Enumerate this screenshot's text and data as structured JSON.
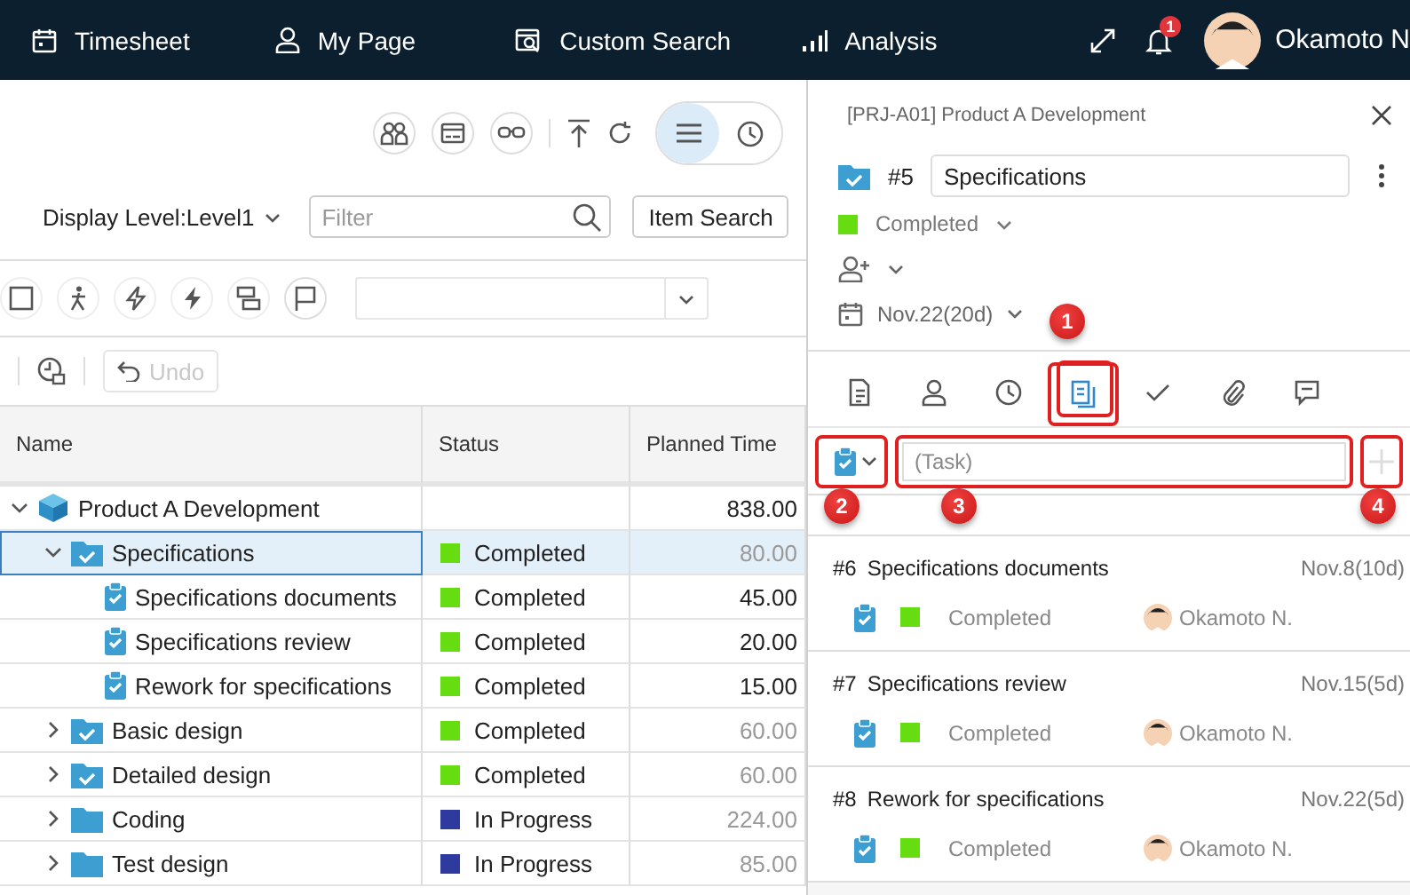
{
  "nav": {
    "items": [
      {
        "label": "Timesheet"
      },
      {
        "label": "My Page"
      },
      {
        "label": "Custom Search"
      },
      {
        "label": "Analysis"
      }
    ],
    "notifications": "1",
    "user": "Okamoto N"
  },
  "toolbar": {
    "view_toggle": [
      {
        "selected": true
      },
      {
        "selected": false
      }
    ],
    "display_level": "Display Level:Level1",
    "filter": {
      "placeholder": "Filter"
    },
    "item_search_button": "Item Search",
    "undo_button": {
      "label": "Undo",
      "disabled": true
    }
  },
  "table": {
    "columns": [
      "Name",
      "Status",
      "Planned Time"
    ],
    "rows": [
      {
        "kind": "project",
        "name": "Product A Development",
        "expanded": true,
        "selected": false,
        "planned": "838.00",
        "children": [
          {
            "kind": "done-folder",
            "name": "Specifications",
            "expanded": true,
            "selected": true,
            "status": "Completed",
            "color": "#66dd11",
            "planned": "80.00",
            "children": [
              {
                "kind": "task",
                "name": "Specifications documents",
                "selected": false,
                "status": "Completed",
                "color": "#66dd11",
                "planned": "45.00"
              },
              {
                "kind": "task",
                "name": "Specifications review",
                "selected": false,
                "status": "Completed",
                "color": "#66dd11",
                "planned": "20.00"
              },
              {
                "kind": "task",
                "name": "Rework for specifications",
                "selected": false,
                "status": "Completed",
                "color": "#66dd11",
                "planned": "15.00"
              }
            ]
          },
          {
            "kind": "done-folder",
            "name": "Basic design",
            "expanded": false,
            "selected": false,
            "status": "Completed",
            "color": "#66dd11",
            "planned": "60.00"
          },
          {
            "kind": "done-folder",
            "name": "Detailed design",
            "expanded": false,
            "selected": false,
            "status": "Completed",
            "color": "#66dd11",
            "planned": "60.00"
          },
          {
            "kind": "folder",
            "name": "Coding",
            "expanded": false,
            "selected": false,
            "status": "In Progress",
            "color": "#2e3a9e",
            "planned": "224.00"
          },
          {
            "kind": "folder",
            "name": "Test design",
            "expanded": false,
            "selected": false,
            "status": "In Progress",
            "color": "#2e3a9e",
            "planned": "85.00"
          }
        ]
      }
    ]
  },
  "detail": {
    "breadcrumb": "[PRJ-A01] Product A Development",
    "number": "#5",
    "title": "Specifications",
    "status": {
      "label": "Completed",
      "color": "#66dd11"
    },
    "due": "Nov.22(20d)",
    "tabs": [
      {
        "selected": false,
        "highlighted": false
      },
      {
        "selected": false,
        "highlighted": false
      },
      {
        "selected": false,
        "highlighted": false
      },
      {
        "selected": true,
        "highlighted": true
      },
      {
        "selected": false,
        "highlighted": false
      },
      {
        "selected": false,
        "highlighted": false
      },
      {
        "selected": false,
        "highlighted": false
      }
    ],
    "type_select": {
      "highlighted": true
    },
    "task_field": {
      "placeholder": "(Task)",
      "highlighted": true
    },
    "add_button": {
      "highlighted": true,
      "disabled": true
    },
    "subtasks": [
      {
        "number": "#6",
        "title": "Specifications documents",
        "date": "Nov.8(10d)",
        "status": "Completed",
        "color": "#66dd11",
        "assignee": "Okamoto N."
      },
      {
        "number": "#7",
        "title": "Specifications review",
        "date": "Nov.15(5d)",
        "status": "Completed",
        "color": "#66dd11",
        "assignee": "Okamoto N."
      },
      {
        "number": "#8",
        "title": "Rework for specifications",
        "date": "Nov.22(5d)",
        "status": "Completed",
        "color": "#66dd11",
        "assignee": "Okamoto N."
      }
    ],
    "callouts": [
      "1",
      "2",
      "3",
      "4"
    ]
  }
}
